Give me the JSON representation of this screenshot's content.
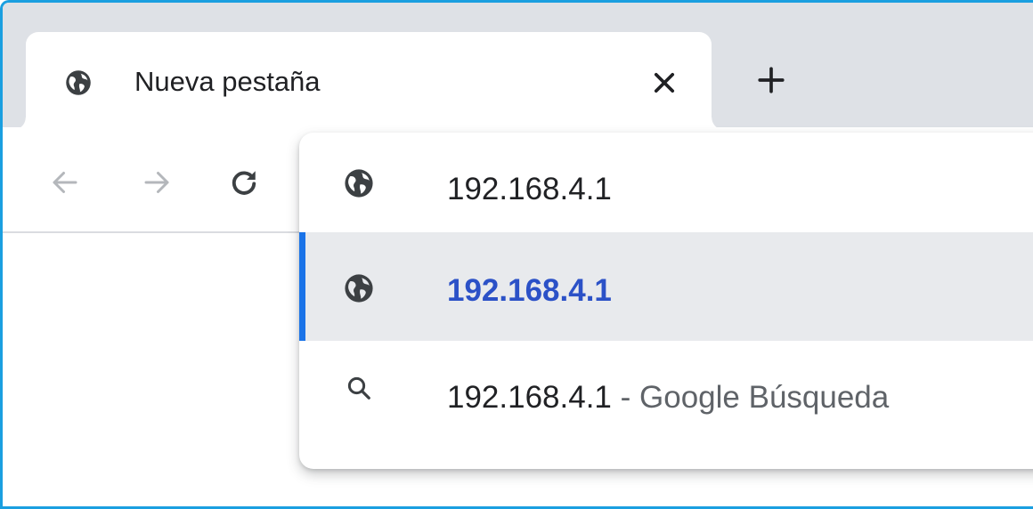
{
  "tab": {
    "title": "Nueva pestaña",
    "icon": "globe-icon",
    "close_icon": "close-icon"
  },
  "new_tab": {
    "icon": "plus-icon"
  },
  "toolbar": {
    "back_icon": "arrow-left-icon",
    "forward_icon": "arrow-right-icon",
    "reload_icon": "reload-icon"
  },
  "omnibox": {
    "suggestions": [
      {
        "text": "192.168.4.1",
        "suffix": "",
        "icon": "globe-icon",
        "selected": false
      },
      {
        "text": "192.168.4.1",
        "suffix": "",
        "icon": "globe-icon",
        "selected": true
      },
      {
        "text": "192.168.4.1",
        "suffix": " - Google Búsqueda",
        "icon": "search-icon",
        "selected": false
      }
    ]
  },
  "colors": {
    "frame_border": "#1a9fe0",
    "tabstrip_bg": "#dee1e6",
    "selected_row_bg": "#e8eaed",
    "selected_accent": "#1a73e8",
    "selected_text": "#2b51c7"
  }
}
